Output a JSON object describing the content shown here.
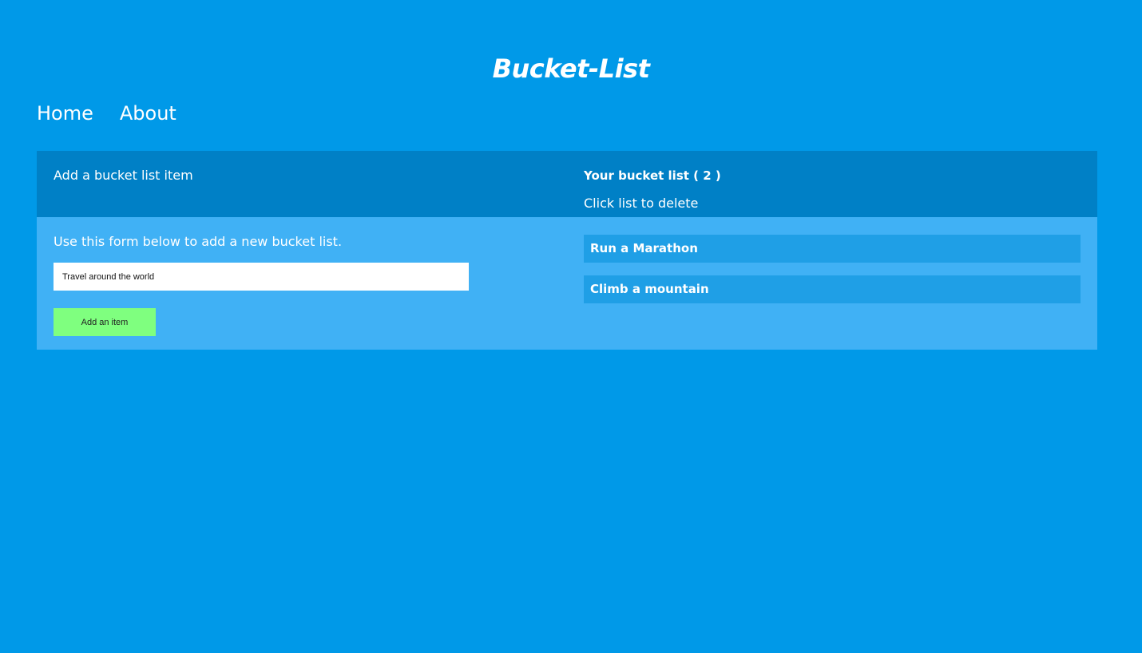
{
  "app": {
    "title": "Bucket-List"
  },
  "nav": {
    "items": [
      {
        "label": "Home"
      },
      {
        "label": "About"
      }
    ]
  },
  "add_panel": {
    "heading": "Add a bucket list item",
    "instructions": "Use this form below to add a new bucket list.",
    "input_value": "Travel around the world",
    "button_label": "Add an item"
  },
  "list_panel": {
    "heading": "Your bucket list ( 2 )",
    "subheading": "Click list to delete",
    "items": [
      {
        "label": "Run a Marathon"
      },
      {
        "label": "Climb a mountain"
      }
    ]
  },
  "colors": {
    "page_background": "#0099e8",
    "header_bar": "#0080c6",
    "panel_body": "#40b1f5",
    "list_item": "#1f9fe6",
    "button": "#7fff7f"
  }
}
